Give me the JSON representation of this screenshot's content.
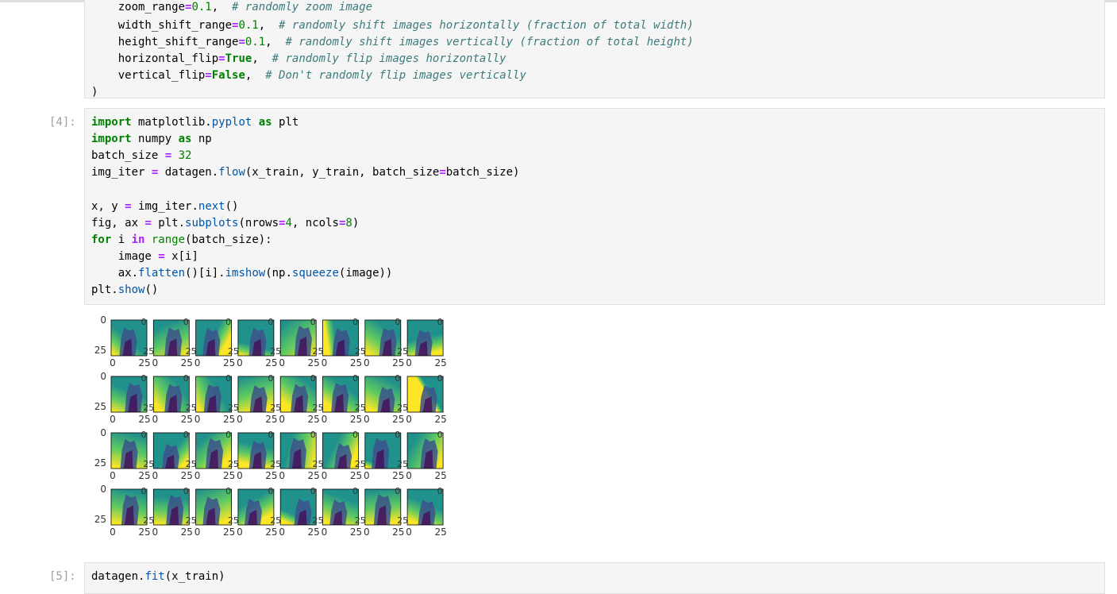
{
  "cells": {
    "cell3": {
      "lines": [
        {
          "indent": "    ",
          "name": "zoom_range",
          "value": "0.1",
          "comment": "# randomly zoom image"
        },
        {
          "indent": "    ",
          "name": "width_shift_range",
          "value": "0.1",
          "comment": "# randomly shift images horizontally (fraction of total width)"
        },
        {
          "indent": "    ",
          "name": "height_shift_range",
          "value": "0.1",
          "comment": "# randomly shift images vertically (fraction of total height)"
        },
        {
          "indent": "    ",
          "name": "horizontal_flip",
          "value": "True",
          "comment": "# randomly flip images horizontally"
        },
        {
          "indent": "    ",
          "name": "vertical_flip",
          "value": "False",
          "comment": "# Don't randomly flip images vertically"
        }
      ],
      "closing": ")"
    },
    "cell4": {
      "prompt": "[4]:",
      "code": {
        "l1_kw": "import",
        "l1_mod": " matplotlib.",
        "l1_sub": "pyplot",
        "l1_as": "as",
        "l1_alias": " plt",
        "l2_kw": "import",
        "l2_mod": " numpy ",
        "l2_as": "as",
        "l2_alias": " np",
        "l3_name": "batch_size ",
        "l3_eq": "=",
        "l3_val": "32",
        "l4_name": "img_iter ",
        "l4_eq": "=",
        "l4_obj": " datagen.",
        "l4_fn": "flow",
        "l4_args1": "(x_train, y_train, batch_size",
        "l4_eq2": "=",
        "l4_args2": "batch_size)",
        "l5_lhs": "x, y ",
        "l5_eq": "=",
        "l5_obj": " img_iter.",
        "l5_fn": "next",
        "l5_end": "()",
        "l6_lhs": "fig, ax ",
        "l6_eq": "=",
        "l6_obj": " plt.",
        "l6_fn": "subplots",
        "l6_a1": "(nrows",
        "l6_eq2": "=",
        "l6_v1": "4",
        "l6_a2": ", ncols",
        "l6_eq3": "=",
        "l6_v2": "8",
        "l6_end": ")",
        "l7_for": "for",
        "l7_i": " i ",
        "l7_in": "in",
        "l7_range": " range",
        "l7_end": "(batch_size):",
        "l8_lhs": "    image ",
        "l8_eq": "=",
        "l8_rhs": " x[i]",
        "l9_a": "    ax.",
        "l9_fn1": "flatten",
        "l9_b": "()[i].",
        "l9_fn2": "imshow",
        "l9_c": "(np.",
        "l9_fn3": "squeeze",
        "l9_d": "(image))",
        "l10_a": "plt.",
        "l10_fn": "show",
        "l10_end": "()"
      }
    },
    "cell5": {
      "prompt": "[5]:",
      "code": {
        "a": "datagen.",
        "fn": "fit",
        "b": "(x_train)"
      }
    }
  },
  "figure": {
    "rows": 4,
    "cols": 8,
    "y_ticks": [
      "0",
      "25"
    ],
    "x_ticks": [
      "0",
      "25"
    ],
    "colormap": [
      "#440154",
      "#3b528b",
      "#21918c",
      "#5ec962",
      "#fde725"
    ]
  }
}
